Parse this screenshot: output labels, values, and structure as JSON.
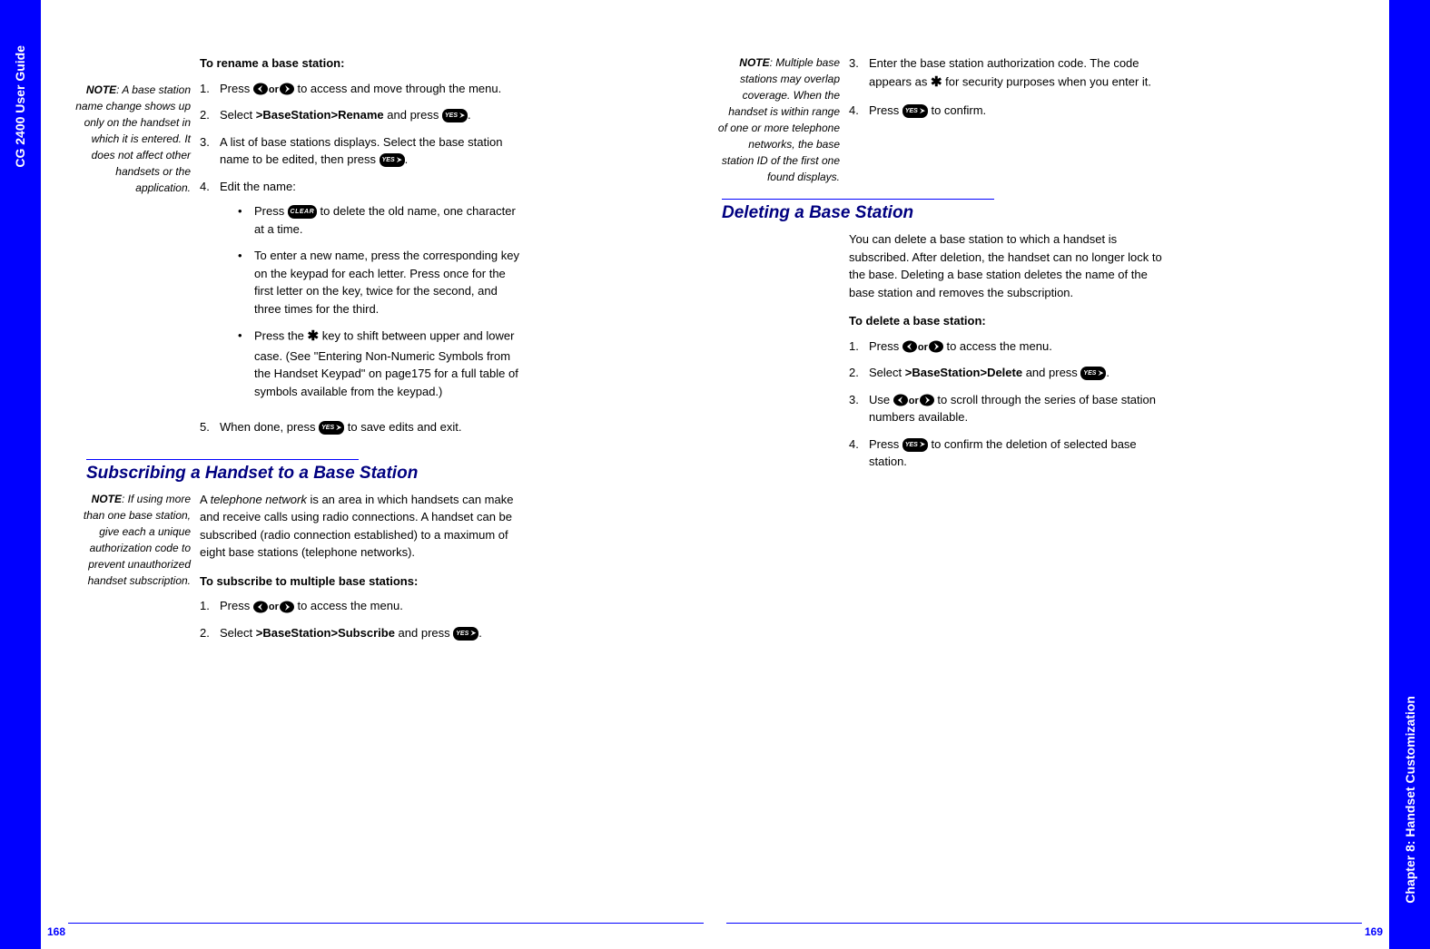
{
  "left_sidebar": "CG 2400 User Guide",
  "right_sidebar": "Chapter 8: Handset Customization",
  "page_left": "168",
  "page_right": "169",
  "rename": {
    "heading": "To rename a base station:",
    "note_label": "NOTE",
    "note": ": A base station name change shows up only on the handset in which it is entered. It does not affect other handsets or the application.",
    "step1_a": "Press ",
    "step1_b": " to access and move through the menu.",
    "step2_a": "Select ",
    "step2_b": ">BaseStation>Rename",
    "step2_c": " and press ",
    "step3": "A list of base stations displays. Select the base station name to be edited, then press ",
    "step4": "Edit the name:",
    "sub1_a": "Press ",
    "sub1_b": " to delete the old name, one character at a time.",
    "sub2": "To enter a new name, press the corresponding key on the keypad for each letter. Press once for the first letter on the key, twice for the second, and three times for the third.",
    "sub3_a": "Press the ",
    "sub3_b": " key to shift between upper and lower case. (See \"Entering Non-Numeric Symbols from the Handset Keypad\" on page175 for a full table of symbols available from the keypad.)",
    "step5_a": "When done, press ",
    "step5_b": " to save edits and exit."
  },
  "subscribe": {
    "title": "Subscribing a Handset to a Base Station",
    "note_label": "NOTE",
    "note": ": If using more than one base station, give each a unique authorization code to prevent unauthorized handset subscription.",
    "para_a": "A ",
    "para_em": "telephone network",
    "para_b": " is an area in which handsets can make and receive calls using radio connections. A handset can be subscribed (radio connection established) to a maximum of eight base stations (telephone networks).",
    "heading": "To subscribe to multiple base stations:",
    "step1_a": "Press ",
    "step1_b": " to access the menu.",
    "step2_a": "Select ",
    "step2_b": ">BaseStation>Subscribe",
    "step2_c": " and press "
  },
  "subscribe_cont": {
    "note_label": "NOTE",
    "note": ": Multiple base stations may overlap coverage. When the handset is within range of one or more telephone networks, the base station ID of the first one found displays.",
    "step3_a": "Enter the base station authorization code. The code appears as ",
    "step3_b": " for security purposes when you enter it.",
    "step4_a": "Press ",
    "step4_b": "to confirm."
  },
  "delete": {
    "title": "Deleting a Base Station",
    "para": "You can delete a base station to which a handset is subscribed. After deletion, the handset can no longer lock to the base. Deleting a base station deletes the name of the base station and removes the subscription.",
    "heading": "To delete a base station:",
    "step1_a": "Press ",
    "step1_b": " to access the menu.",
    "step2_a": "Select ",
    "step2_b": ">BaseStation>Delete",
    "step2_c": " and press ",
    "step3_a": "Use ",
    "step3_b": " to scroll through the series of base station numbers available.",
    "step4_a": "Press ",
    "step4_b": " to confirm the deletion of selected base station."
  },
  "icons": {
    "or": "or",
    "yes": "YES",
    "clear": "CLEAR"
  }
}
